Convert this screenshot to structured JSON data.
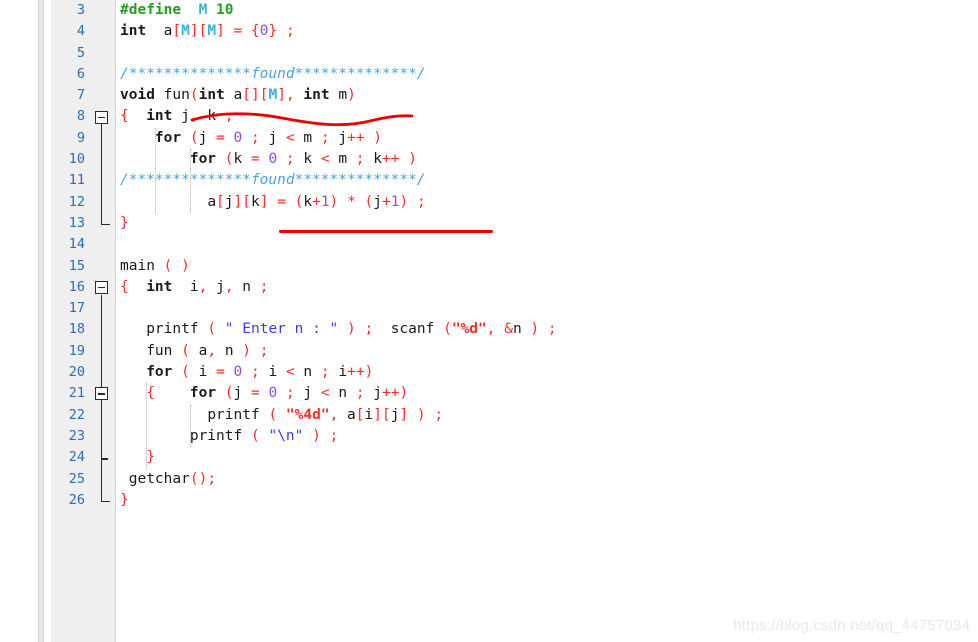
{
  "app": {
    "kind": "code-editor",
    "language": "C",
    "theme": "light"
  },
  "watermark": {
    "text": "https://blog.csdn.net/qq_44757034"
  },
  "gutter": {
    "first_line": 3,
    "last_line": 26,
    "line_numbers": [
      "3",
      "4",
      "5",
      "6",
      "7",
      "8",
      "9",
      "10",
      "11",
      "12",
      "13",
      "14",
      "15",
      "16",
      "17",
      "18",
      "19",
      "20",
      "21",
      "22",
      "23",
      "24",
      "25",
      "26"
    ]
  },
  "fold_markers": [
    {
      "line": 8,
      "type": "collapse-box"
    },
    {
      "line": 13,
      "type": "region-end"
    },
    {
      "line": 16,
      "type": "collapse-box"
    },
    {
      "line": 21,
      "type": "collapse-box"
    },
    {
      "line": 24,
      "type": "region-tick"
    },
    {
      "line": 26,
      "type": "region-end"
    }
  ],
  "colors": {
    "background": "#ffffff",
    "gutter_bg": "#efefef",
    "line_number": "#2b6cb8",
    "punctuation": "#ff2b2b",
    "number": "#8d4fd4",
    "string": "#3b3bff",
    "format_string": "#ff2b2b",
    "preprocessor": "#22a022",
    "macro_name": "#3bb0d8",
    "comment": "#4aa3e8",
    "annotation_red": "#ee0000",
    "watermark": "#e9e9e9",
    "indent_guide": "#b5b5b5"
  },
  "code": {
    "lines": [
      {
        "n": "3",
        "text": "#define  M 10"
      },
      {
        "n": "4",
        "text": "int  a[M][M] = {0} ;"
      },
      {
        "n": "5",
        "text": ""
      },
      {
        "n": "6",
        "text": "/**************found**************/"
      },
      {
        "n": "7",
        "text": "void fun(int a[][M], int m)"
      },
      {
        "n": "8",
        "text": "{  int j, k ;"
      },
      {
        "n": "9",
        "text": "    for (j = 0 ; j < m ; j++ )"
      },
      {
        "n": "10",
        "text": "        for (k = 0 ; k < m ; k++ )"
      },
      {
        "n": "11",
        "text": "/**************found**************/"
      },
      {
        "n": "12",
        "text": "          a[j][k] = (k+1) * (j+1) ;"
      },
      {
        "n": "13",
        "text": "}"
      },
      {
        "n": "14",
        "text": ""
      },
      {
        "n": "15",
        "text": "main ( )"
      },
      {
        "n": "16",
        "text": "{  int  i, j, n ;"
      },
      {
        "n": "17",
        "text": ""
      },
      {
        "n": "18",
        "text": "   printf ( \" Enter n : \" ) ;  scanf (\"%d\", &n ) ;"
      },
      {
        "n": "19",
        "text": "   fun ( a, n ) ;"
      },
      {
        "n": "20",
        "text": "   for ( i = 0 ; i < n ; i++)"
      },
      {
        "n": "21",
        "text": "   {    for (j = 0 ; j < n ; j++)"
      },
      {
        "n": "22",
        "text": "          printf ( \"%4d\", a[i][j] ) ;"
      },
      {
        "n": "23",
        "text": "        printf ( \"\\n\" ) ;"
      },
      {
        "n": "24",
        "text": "   }"
      },
      {
        "n": "25",
        "text": " getchar();"
      },
      {
        "n": "26",
        "text": "}"
      }
    ],
    "comment_marker_text": "found",
    "comment_asterisks_left": "**************",
    "comment_asterisks_right": "**************"
  },
  "annotations": [
    {
      "id": "underline-int-params",
      "shape": "wavy-underline",
      "target_line": 7,
      "target_text": "int a[][M], int m",
      "color": "#ee0000"
    },
    {
      "id": "underline-assignment",
      "shape": "straight-underline",
      "target_line": 12,
      "target_text": "(k+1) * (j+1)",
      "color": "#ee0000"
    }
  ]
}
